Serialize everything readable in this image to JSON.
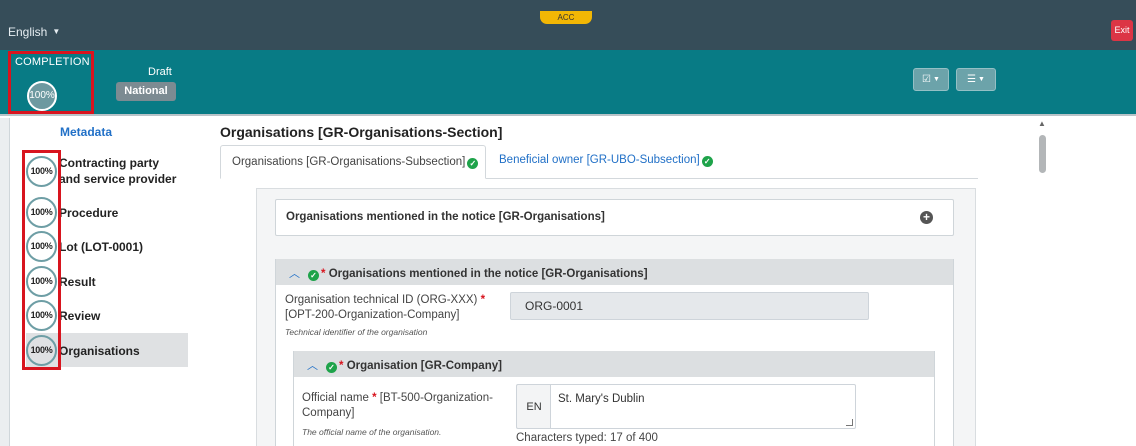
{
  "topbar": {
    "language": "English",
    "env_badge": "ACC",
    "exit_label": "Exit"
  },
  "header": {
    "completion_label": "COMPLETION",
    "completion_value": "100%",
    "status": "Draft",
    "scope_badge": "National",
    "buttons": [
      {
        "icon": "checklist-icon",
        "glyph": "☑"
      },
      {
        "icon": "sliders-icon",
        "glyph": "☰"
      }
    ]
  },
  "sidebar": {
    "metadata_label": "Metadata",
    "items": [
      {
        "progress": "100%",
        "label": "Contracting party and service provider"
      },
      {
        "progress": "100%",
        "label": "Procedure"
      },
      {
        "progress": "100%",
        "label": "Lot (LOT-0001)"
      },
      {
        "progress": "100%",
        "label": "Result"
      },
      {
        "progress": "100%",
        "label": "Review"
      },
      {
        "progress": "100%",
        "label": "Organisations",
        "active": true
      }
    ]
  },
  "main": {
    "section_title": "Organisations [GR-Organisations-Section]",
    "tabs": [
      {
        "label": "Organisations  [GR-Organisations-Subsection]",
        "active": true,
        "complete": true
      },
      {
        "label": "Beneficial owner  [GR-UBO-Subsection]",
        "active": false,
        "complete": true
      }
    ],
    "collapsed_group_title": "Organisations mentioned in the notice  [GR-Organisations]",
    "expanded_group": {
      "required_mark": "*",
      "title": "Organisations mentioned in the notice  [GR-Organisations]",
      "technical_id": {
        "label": "Organisation technical ID (ORG-XXX)",
        "required_mark": "*",
        "code": "[OPT-200-Organization-Company]",
        "hint": "Technical identifier of the organisation",
        "value": "ORG-0001"
      },
      "company": {
        "required_mark": "*",
        "title": "Organisation  [GR-Company]",
        "official_name": {
          "label": "Official name",
          "required_mark": "*",
          "code": "[BT-500-Organization-Company]",
          "hint": "The official name of the organisation.",
          "language": "EN",
          "value": "St. Mary's Dublin",
          "char_count": "Characters typed: 17 of 400"
        }
      }
    }
  },
  "colors": {
    "topbar": "#364d59",
    "header_band": "#087b85",
    "highlight_box": "#d8141e",
    "link": "#2170c7",
    "success": "#1ea34a"
  }
}
